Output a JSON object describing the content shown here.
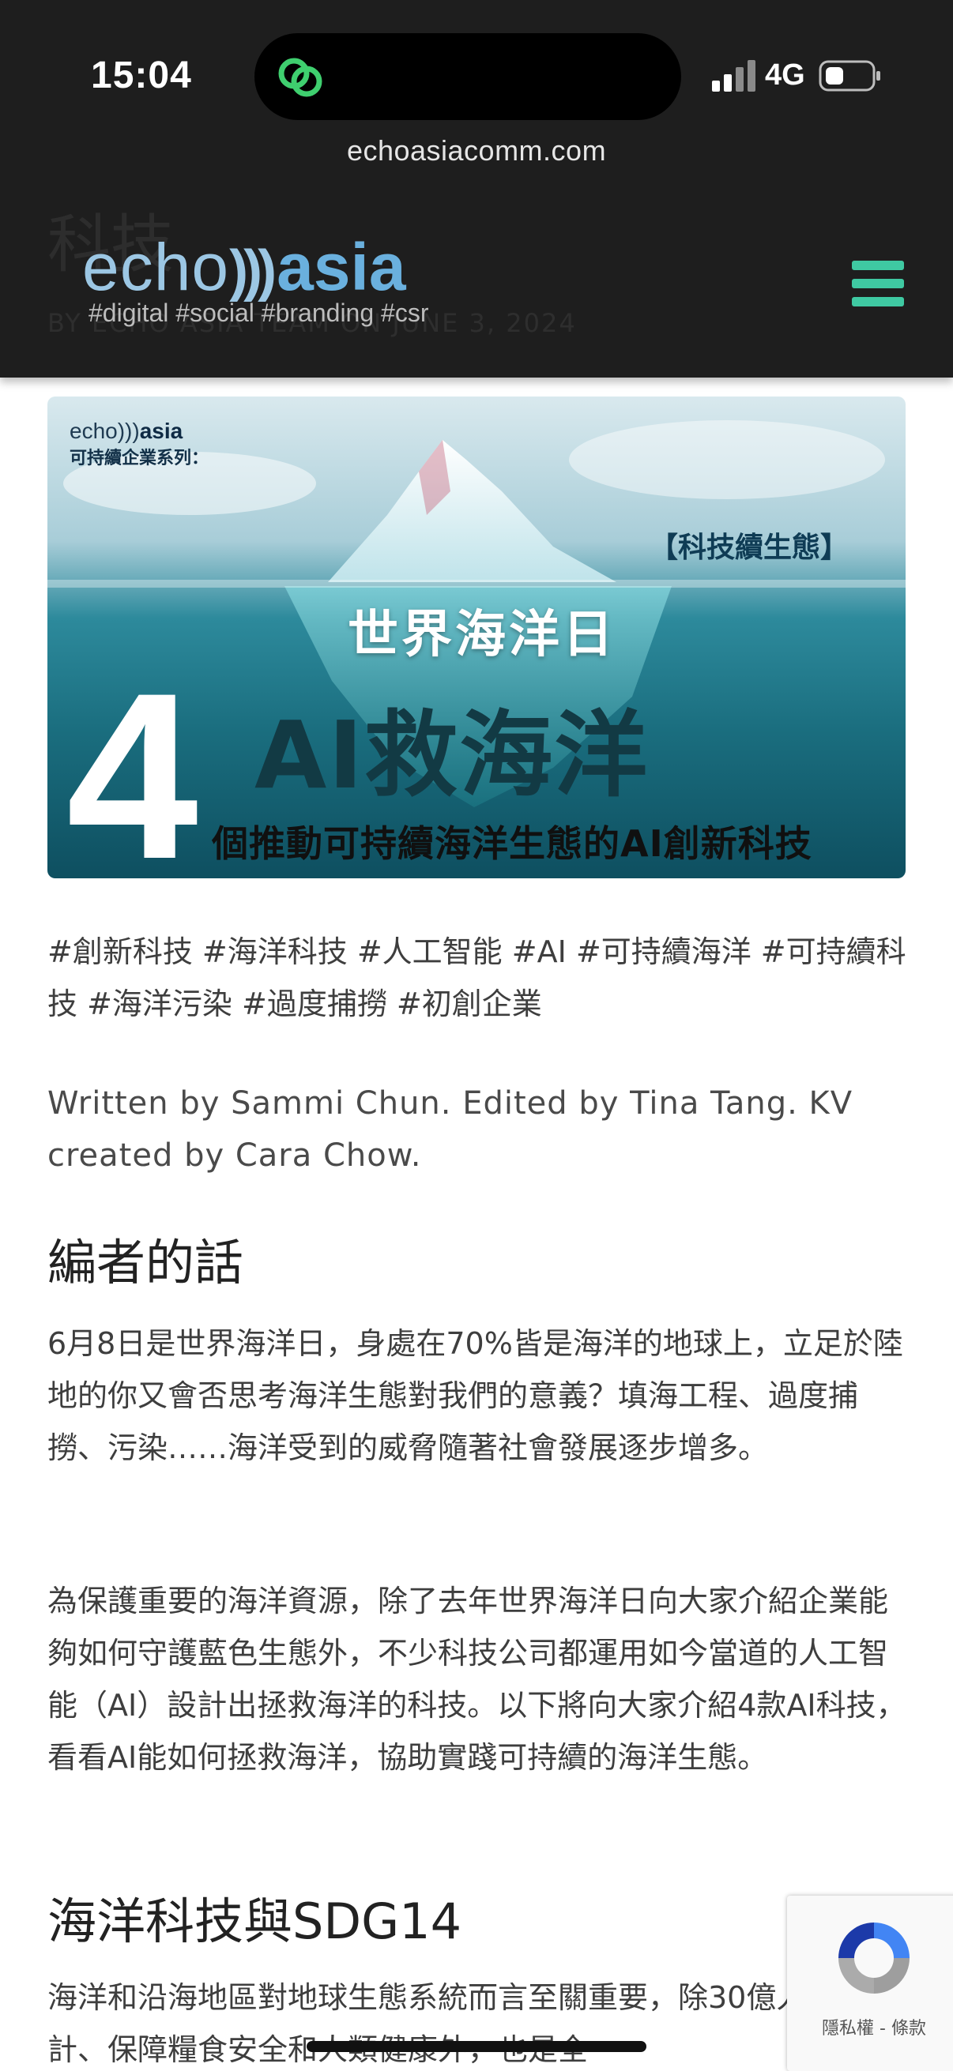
{
  "status_bar": {
    "time": "15:04",
    "network": "4G"
  },
  "browser": {
    "url": "echoasiacomm.com"
  },
  "site_header": {
    "logo_echo": "echo",
    "logo_waves": ")))",
    "logo_asia": "asia",
    "tagline": "#digital #social #branding #csr",
    "ghost_title": "科技",
    "ghost_meta": "BY ECHO ASIA TEAM  ON JUNE 3, 2024"
  },
  "hero": {
    "brand_echo": "echo)))",
    "brand_asia": "asia",
    "series": "可持續企業系列：",
    "tag": "【科技續生態】",
    "subtitle": "世界海洋日",
    "main": "AI救海洋",
    "number": "4",
    "bottom": "個推動可持續海洋生態的AI創新科技"
  },
  "article": {
    "tags": "#創新科技 #海洋科技 #人工智能 #AI #可持續海洋 #可持續科技 #海洋污染 #過度捕撈 #初創企業",
    "written_by": "Written by Sammi Chun. Edited by Tina Tang. KV created by Cara Chow.",
    "heading_editor": "編者的話",
    "para1": "6月8日是世界海洋日，身處在70%皆是海洋的地球上，立足於陸地的你又會否思考海洋生態對我們的意義？填海工程、過度捕撈、污染……海洋受到的威脅隨著社會發展逐步增多。",
    "para2": "為保護重要的海洋資源，除了去年世界海洋日向大家介紹企業能夠如何守護藍色生態外，不少科技公司都運用如今當道的人工智能（AI）設計出拯救海洋的科技。以下將向大家介紹4款AI科技，看看AI能如何拯救海洋，協助實踐可持續的海洋生態。",
    "heading_sdg": "海洋科技與SDG14",
    "para3": "海洋和沿海地區對地球生態系統而言至關重要，除30億人提供生計、保障糧食安全和人類健康外，也是全"
  },
  "recaptcha": {
    "text": "隱私權 - 條款"
  },
  "colors": {
    "chrome_bg": "#1e1e1e",
    "accent_teal": "#3fc9a2",
    "logo_blue": "#6ab0de"
  }
}
